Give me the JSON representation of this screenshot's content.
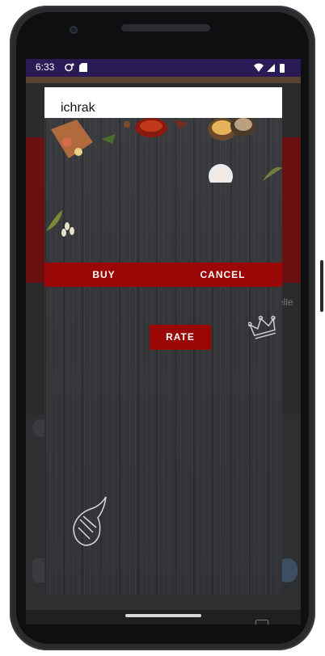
{
  "status_bar": {
    "time": "6:33",
    "icons": [
      "notification-icon",
      "sd-card-icon",
      "wifi-icon",
      "signal-icon",
      "battery-icon"
    ],
    "background_color": "#2a1a56"
  },
  "dialog": {
    "title": "ichrak",
    "buy_label": "BUY",
    "cancel_label": "CANCEL",
    "rate_label": "RATE",
    "button_color": "#9b0606"
  },
  "background_app": {
    "partial_text_right": "elle"
  },
  "navigation": {
    "back_icon": "chevron-down-icon",
    "keyboard_icon": "keyboard-icon"
  }
}
